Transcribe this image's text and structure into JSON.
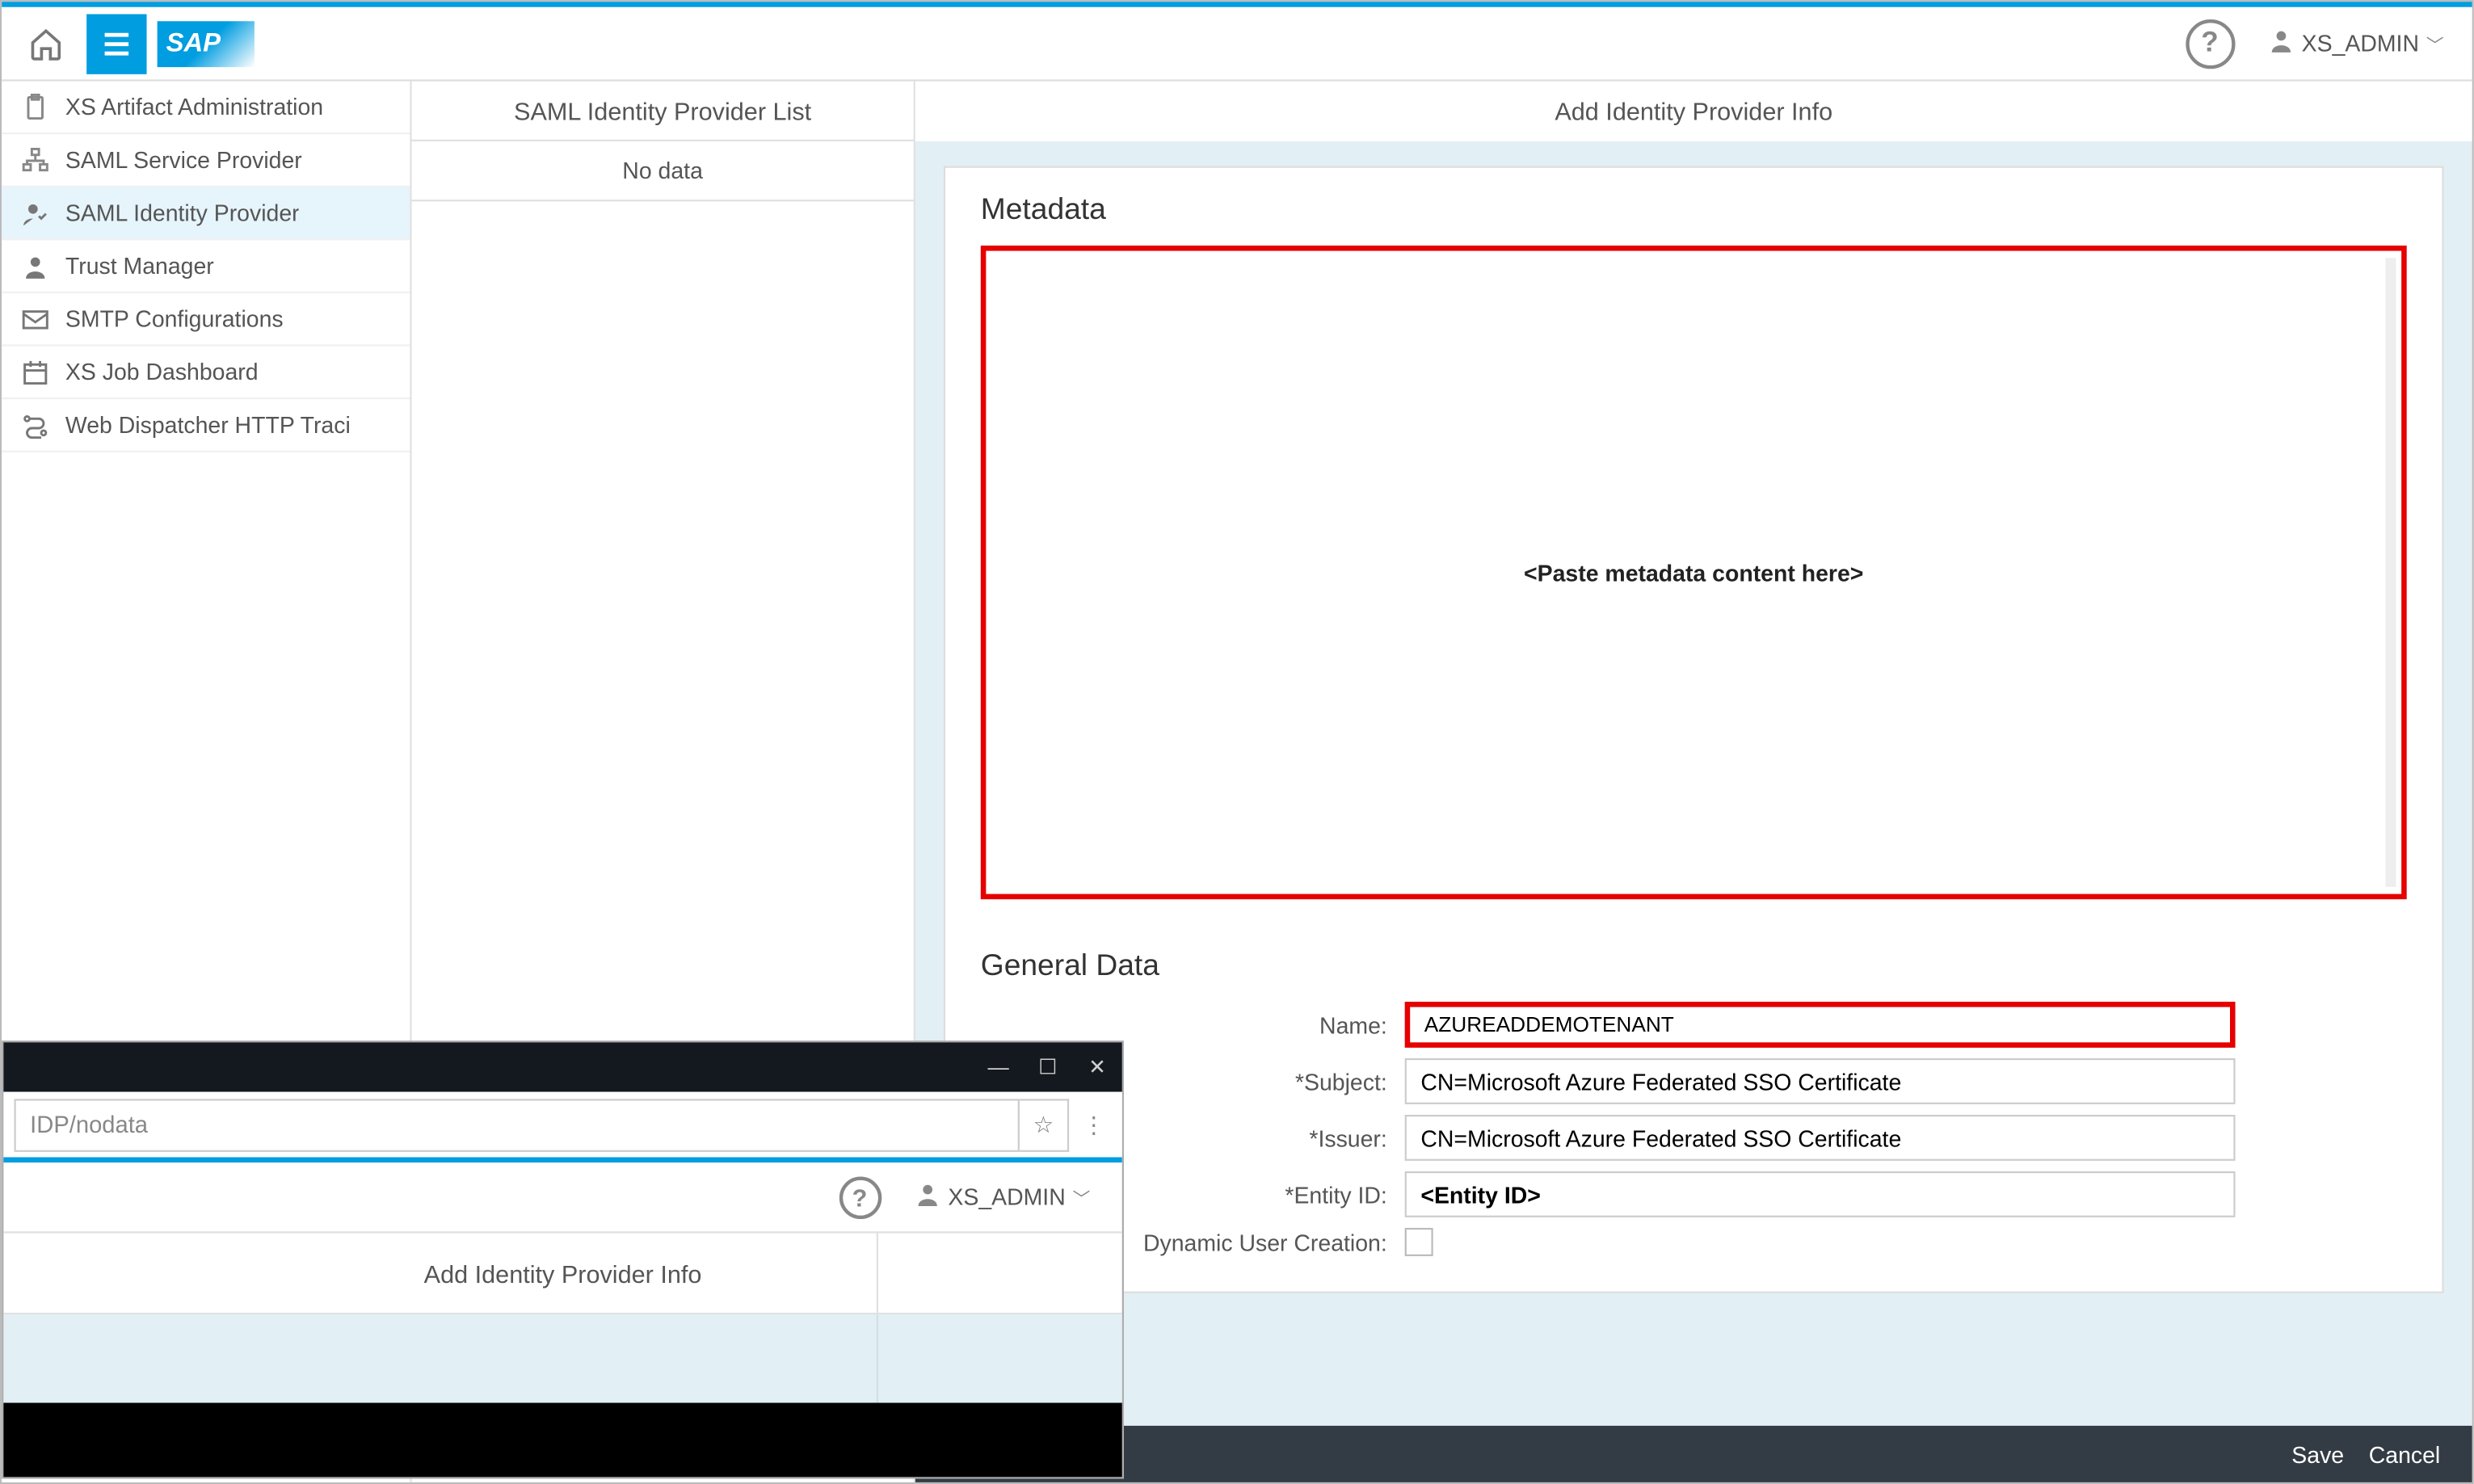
{
  "topbar": {
    "brand": "SAP",
    "user_label": "XS_ADMIN"
  },
  "sidebar": {
    "items": [
      {
        "label": "XS Artifact Administration",
        "icon": "clipboard-icon"
      },
      {
        "label": "SAML Service Provider",
        "icon": "org-icon"
      },
      {
        "label": "SAML Identity Provider",
        "icon": "person-check-icon"
      },
      {
        "label": "Trust Manager",
        "icon": "person-icon"
      },
      {
        "label": "SMTP Configurations",
        "icon": "envelope-icon"
      },
      {
        "label": "XS Job Dashboard",
        "icon": "calendar-icon"
      },
      {
        "label": "Web Dispatcher HTTP Traci",
        "icon": "route-icon"
      }
    ]
  },
  "middle": {
    "header": "SAML Identity Provider List",
    "empty_text": "No data"
  },
  "content": {
    "header": "Add Identity Provider Info",
    "metadata_section": "Metadata",
    "metadata_placeholder": "<Paste metadata content here>",
    "general_section": "General Data",
    "fields": {
      "name_label": "Name:",
      "name_value": "AZUREADDEMOTENANT",
      "subject_label": "*Subject:",
      "subject_value": "CN=Microsoft Azure Federated SSO Certificate",
      "issuer_label": "*Issuer:",
      "issuer_value": "CN=Microsoft Azure Federated SSO Certificate",
      "entity_label": "*Entity ID:",
      "entity_value": "<Entity ID>",
      "dynamic_label": "Dynamic User Creation:"
    }
  },
  "footer": {
    "save": "Save",
    "cancel": "Cancel"
  },
  "popup": {
    "url": "IDP/nodata",
    "user_label": "XS_ADMIN",
    "title": "Add Identity Provider Info"
  }
}
